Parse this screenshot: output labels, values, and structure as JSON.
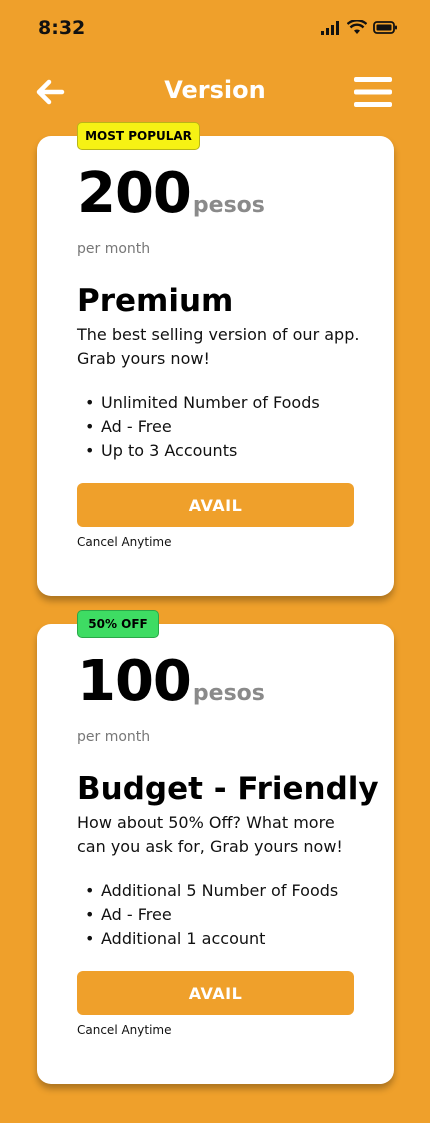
{
  "status_bar": {
    "time": "8:32"
  },
  "header": {
    "title": "Version"
  },
  "plans": [
    {
      "badge": "MOST POPULAR",
      "price": "200",
      "unit": "pesos",
      "period": "per month",
      "name": "Premium",
      "description": "The best selling version of our app. Grab yours now!",
      "features": [
        "Unlimited Number of Foods",
        "Ad - Free",
        "Up to 3 Accounts"
      ],
      "button_label": "AVAIL",
      "note": "Cancel Anytime"
    },
    {
      "badge": "50% OFF",
      "price": "100",
      "unit": "pesos",
      "period": "per month",
      "name": "Budget - Friendly",
      "description": "How about 50% Off? What more can you ask for, Grab yours now!",
      "features": [
        "Additional 5 Number of Foods",
        "Ad - Free",
        "Additional 1 account"
      ],
      "button_label": "AVAIL",
      "note": "Cancel Anytime"
    }
  ],
  "colors": {
    "background": "#EFA02B",
    "popular_badge": "#F6F214",
    "discount_badge": "#3EDC63",
    "button": "#EFA02B"
  },
  "icons": {
    "back": "arrow-left-icon",
    "menu": "hamburger-menu-icon",
    "signal": "cellular-signal-icon",
    "wifi": "wifi-icon",
    "battery": "battery-icon"
  }
}
